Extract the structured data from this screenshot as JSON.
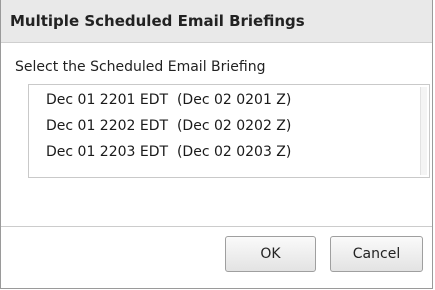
{
  "dialog": {
    "title": "Multiple Scheduled Email Briefings",
    "prompt": "Select the Scheduled Email Briefing",
    "items": [
      {
        "label": "Dec 01 2201 EDT  (Dec 02 0201 Z)"
      },
      {
        "label": "Dec 01 2202 EDT  (Dec 02 0202 Z)"
      },
      {
        "label": "Dec 01 2203 EDT  (Dec 02 0203 Z)"
      }
    ],
    "buttons": {
      "ok_label": "OK",
      "cancel_label": "Cancel"
    }
  }
}
